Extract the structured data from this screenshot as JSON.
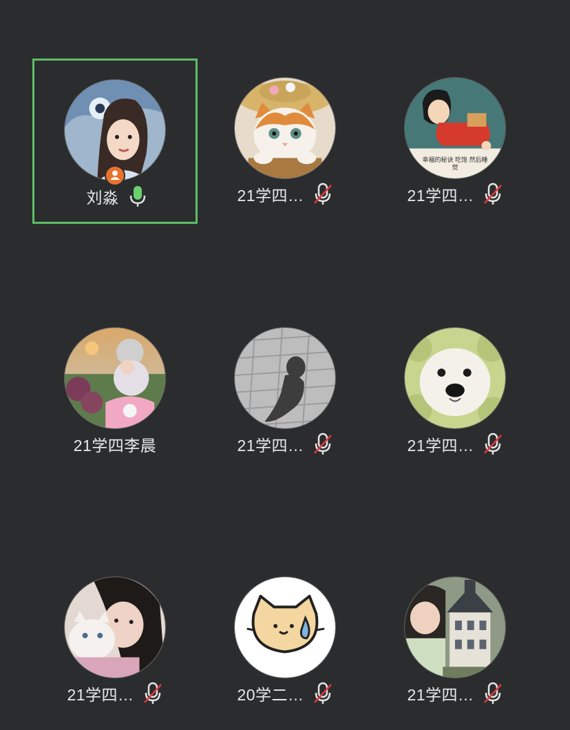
{
  "participants": [
    {
      "name": "刘淼",
      "mic": "on",
      "avatar": "girl-illustration-icon",
      "host": true,
      "active": true
    },
    {
      "name": "21学四…",
      "mic": "muted",
      "avatar": "kitten-hat-icon"
    },
    {
      "name": "21学四…",
      "mic": "muted",
      "avatar": "cartoon-girl-icon",
      "avatar_text": "幸福的秘诀  吃饱 然后睡觉"
    },
    {
      "name": "21学四李晨",
      "mic": "none",
      "avatar": "girl-scooter-photo-icon"
    },
    {
      "name": "21学四…",
      "mic": "muted",
      "avatar": "shadow-pavement-photo-icon"
    },
    {
      "name": "21学四…",
      "mic": "muted",
      "avatar": "white-dog-icon"
    },
    {
      "name": "21学四…",
      "mic": "muted",
      "avatar": "girl-with-cat-photo-icon"
    },
    {
      "name": "20学二…",
      "mic": "muted",
      "avatar": "cartoon-cat-sweat-icon"
    },
    {
      "name": "21学四…",
      "mic": "muted",
      "avatar": "girl-with-castle-model-icon"
    }
  ],
  "colors": {
    "background": "#2b2c2e",
    "active_border": "#5dbe6a",
    "mic_on": "#69d26e",
    "mic_muted_slash": "#e0393e",
    "host_badge": "#e8722f"
  }
}
